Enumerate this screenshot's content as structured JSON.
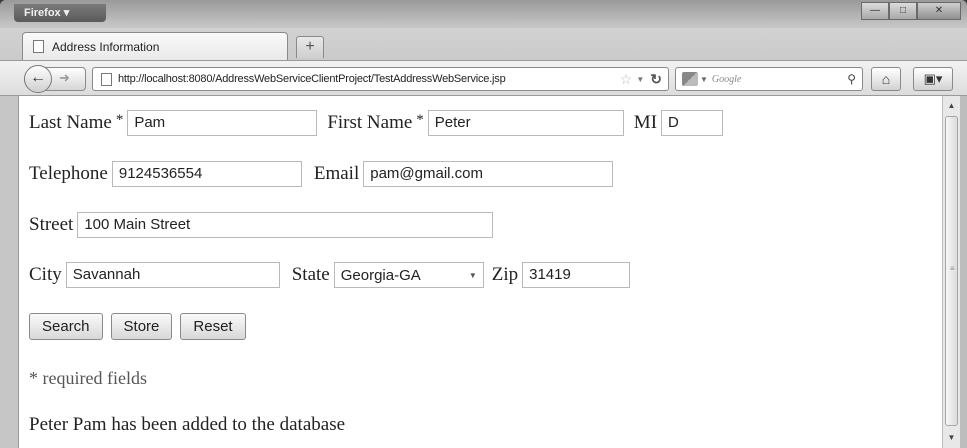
{
  "browser": {
    "app_button": "Firefox ▾",
    "tab_title": "Address Information",
    "new_tab": "+",
    "url": "http://localhost:8080/AddressWebServiceClientProject/TestAddressWebService.jsp",
    "search_placeholder": "Google"
  },
  "form": {
    "last_name_label": "Last Name",
    "last_name_value": "Pam",
    "first_name_label": "First Name",
    "first_name_value": "Peter",
    "required_mark": "*",
    "mi_label": "MI",
    "mi_value": "D",
    "telephone_label": "Telephone",
    "telephone_value": "9124536554",
    "email_label": "Email",
    "email_value": "pam@gmail.com",
    "street_label": "Street",
    "street_value": "100 Main Street",
    "city_label": "City",
    "city_value": "Savannah",
    "state_label": "State",
    "state_value": "Georgia-GA",
    "zip_label": "Zip",
    "zip_value": "31419",
    "buttons": {
      "search": "Search",
      "store": "Store",
      "reset": "Reset"
    },
    "required_note": "* required fields",
    "status_message": "Peter Pam has been added to the database"
  }
}
